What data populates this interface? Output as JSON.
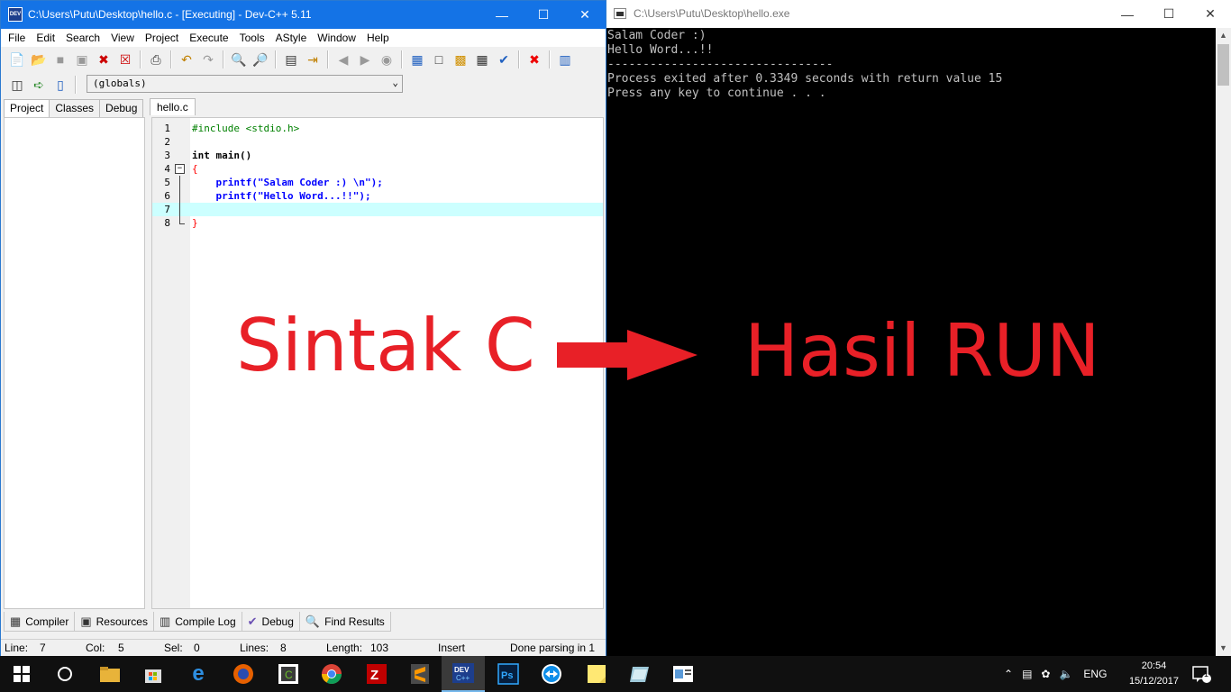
{
  "devcpp": {
    "title": "C:\\Users\\Putu\\Desktop\\hello.c - [Executing] - Dev-C++ 5.11",
    "icon_text": "DEV",
    "menu": [
      "File",
      "Edit",
      "Search",
      "View",
      "Project",
      "Execute",
      "Tools",
      "AStyle",
      "Window",
      "Help"
    ],
    "scope_select": "(globals)",
    "left_tabs": [
      "Project",
      "Classes",
      "Debug"
    ],
    "editor_tab": "hello.c",
    "code_lines": [
      {
        "n": "1",
        "text": "#include <stdio.h>"
      },
      {
        "n": "2",
        "text": ""
      },
      {
        "n": "3",
        "text": "int main()"
      },
      {
        "n": "4",
        "text": "{"
      },
      {
        "n": "5",
        "text": "    printf(\"Salam Coder :) \\n\");"
      },
      {
        "n": "6",
        "text": "    printf(\"Hello Word...!!\");"
      },
      {
        "n": "7",
        "text": ""
      },
      {
        "n": "8",
        "text": "}"
      }
    ],
    "bottom_tabs": [
      "Compiler",
      "Resources",
      "Compile Log",
      "Debug",
      "Find Results"
    ],
    "status": {
      "line_label": "Line:",
      "line": "7",
      "col_label": "Col:",
      "col": "5",
      "sel_label": "Sel:",
      "sel": "0",
      "lines_label": "Lines:",
      "lines": "8",
      "length_label": "Length:",
      "length": "103",
      "mode": "Insert",
      "message": "Done parsing in 1"
    }
  },
  "console": {
    "title": "C:\\Users\\Putu\\Desktop\\hello.exe",
    "lines": [
      "Salam Coder :)",
      "Hello Word...!!",
      "--------------------------------",
      "Process exited after 0.3349 seconds with return value 15",
      "Press any key to continue . . ."
    ]
  },
  "annotation": {
    "left_text": "Sintak C",
    "right_text": "Hasil RUN",
    "color": "#e82027"
  },
  "taskbar": {
    "apps": [
      "windows-start",
      "cortana",
      "file-explorer",
      "store",
      "edge",
      "firefox",
      "codeblocks",
      "chrome",
      "filezilla",
      "sublime-text",
      "dev-cpp",
      "photoshop",
      "teamviewer",
      "sticky-notes",
      "notepad-app",
      "console-app"
    ],
    "language": "ENG",
    "time": "20:54",
    "date": "15/12/2017",
    "notification_count": "1"
  }
}
